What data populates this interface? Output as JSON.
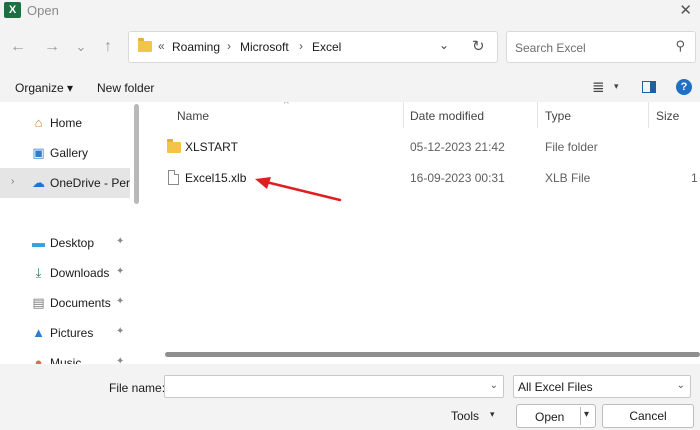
{
  "window": {
    "title": "Open",
    "close_glyph": "✕",
    "app_icon_letter": "X"
  },
  "nav": {
    "back_glyph": "←",
    "forward_glyph": "→",
    "recent_glyph": "⌄",
    "up_glyph": "↑"
  },
  "address": {
    "overflow": "«",
    "crumbs": [
      "Roaming",
      "Microsoft",
      "Excel"
    ],
    "separator": "›",
    "dropdown_glyph": "⌄",
    "refresh_glyph": "↻"
  },
  "search": {
    "placeholder": "Search Excel",
    "icon_glyph": "⚲"
  },
  "toolbar": {
    "organize_label": "Organize ▾",
    "new_folder_label": "New folder",
    "view_glyph": "≣",
    "view_drop": "▾",
    "help_glyph": "?"
  },
  "sidebar": {
    "items": [
      {
        "label": "Home",
        "icon": "⌂",
        "icon_color": "#d9822b"
      },
      {
        "label": "Gallery",
        "icon": "▣",
        "icon_color": "#2e7dd1"
      },
      {
        "label": "OneDrive - Pers",
        "icon": "☁",
        "icon_color": "#1e73d6",
        "chevron": "›"
      },
      {
        "label": "Desktop",
        "icon": "▬",
        "icon_color": "#3aa0d8",
        "pin": "✦"
      },
      {
        "label": "Downloads",
        "icon": "⤓",
        "icon_color": "#1f8a4c",
        "pin": "✦"
      },
      {
        "label": "Documents",
        "icon": "▤",
        "icon_color": "#7a7a7a",
        "pin": "✦"
      },
      {
        "label": "Pictures",
        "icon": "▲",
        "icon_color": "#2e7dd1",
        "pin": "✦"
      },
      {
        "label": "Music",
        "icon": "●",
        "icon_color": "#e06a50",
        "pin": "✦"
      }
    ]
  },
  "columns": {
    "name": "Name",
    "date": "Date modified",
    "type": "Type",
    "size": "Size",
    "sort_glyph": "^"
  },
  "files": [
    {
      "name": "XLSTART",
      "date": "05-12-2023 21:42",
      "type": "File folder",
      "size": "",
      "kind": "folder"
    },
    {
      "name": "Excel15.xlb",
      "date": "16-09-2023 00:31",
      "type": "XLB File",
      "size": "1",
      "kind": "file"
    }
  ],
  "annotation": {
    "arrow_color": "#e02020"
  },
  "bottom": {
    "file_name_label": "File name:",
    "file_name_value": "",
    "filter_value": "All Excel Files",
    "drop_glyph": "⌄",
    "tools_label": "Tools",
    "tools_drop": "▾",
    "open_label": "Open",
    "open_drop": "▾",
    "cancel_label": "Cancel"
  }
}
